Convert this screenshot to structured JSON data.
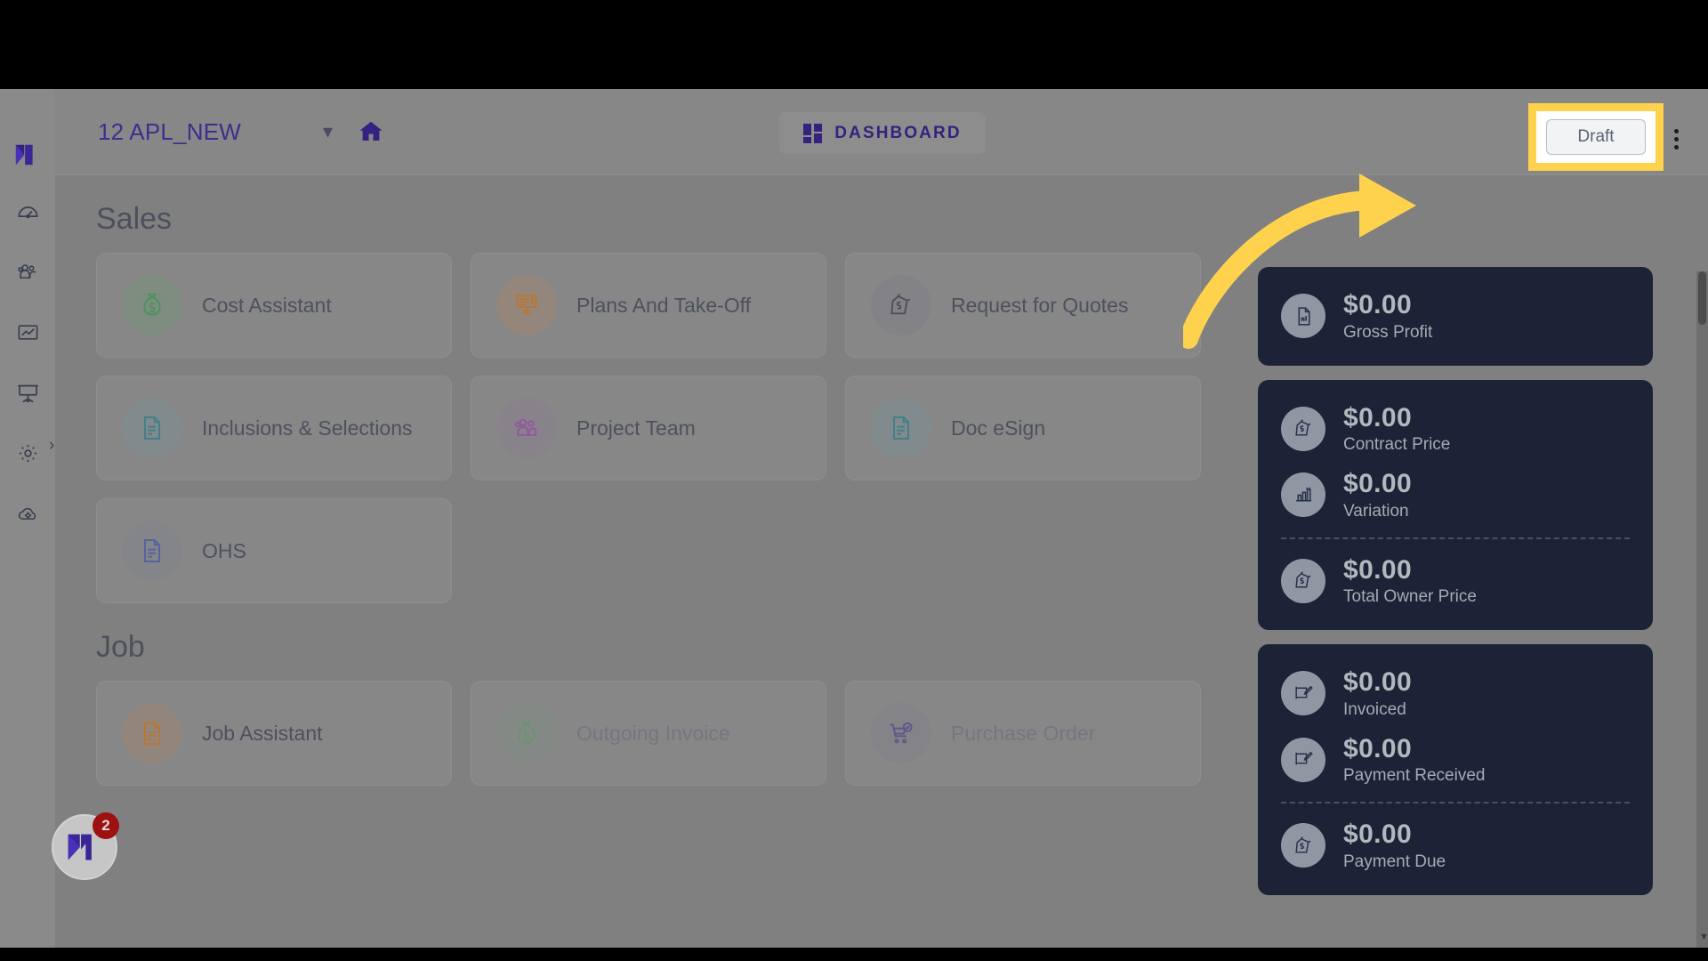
{
  "topbar": {
    "project_name": "12 APL_NEW",
    "chevron": "chevron-down",
    "home_icon": "home-icon",
    "dashboard_label": "DASHBOARD",
    "draft_label": "Draft",
    "kebab": "more-options"
  },
  "sidebar": {
    "items": [
      {
        "icon": "speedometer-icon",
        "name": "dashboard"
      },
      {
        "icon": "people-group-icon",
        "name": "contacts"
      },
      {
        "icon": "chart-frame-icon",
        "name": "reports"
      },
      {
        "icon": "presentation-board-icon",
        "name": "plans"
      },
      {
        "icon": "gear-icon",
        "name": "settings"
      },
      {
        "icon": "cloud-gear-icon",
        "name": "integrations"
      }
    ],
    "expand_chevron": "›"
  },
  "sections": [
    {
      "title": "Sales",
      "cards": [
        {
          "label": "Cost Assistant",
          "icon": "money-bag-icon",
          "color": "#2f9e44",
          "bg": "rgba(91,173,104,0.30)",
          "faded": false
        },
        {
          "label": "Plans And Take-Off",
          "icon": "presentation-icon",
          "color": "#d9730d",
          "bg": "rgba(209,134,70,0.30)",
          "faded": false
        },
        {
          "label": "Request for Quotes",
          "icon": "price-tag-icon",
          "color": "#2c3247",
          "bg": "rgba(120,124,140,0.34)",
          "faded": false
        },
        {
          "label": "Inclusions & Selections",
          "icon": "document-icon",
          "color": "#1e7f8e",
          "bg": "rgba(106,160,172,0.28)",
          "faded": false
        },
        {
          "label": "Project Team",
          "icon": "people-group-icon",
          "color": "#a33bb5",
          "bg": "rgba(150,110,170,0.22)",
          "faded": false
        },
        {
          "label": "Doc eSign",
          "icon": "document-icon",
          "color": "#1e7f8e",
          "bg": "rgba(106,160,172,0.28)",
          "faded": false
        },
        {
          "label": "OHS",
          "icon": "document-icon",
          "color": "#3b52b5",
          "bg": "rgba(120,128,160,0.22)",
          "faded": false
        }
      ]
    },
    {
      "title": "Job",
      "cards": [
        {
          "label": "Job Assistant",
          "icon": "document-icon",
          "color": "#d9730d",
          "bg": "rgba(209,134,70,0.26)",
          "faded": false
        },
        {
          "label": "Outgoing Invoice",
          "icon": "money-bag-icon",
          "color": "#5d9f68",
          "bg": "rgba(110,160,120,0.20)",
          "faded": true
        },
        {
          "label": "Purchase Order",
          "icon": "cart-check-icon",
          "color": "#4b3f8f",
          "bg": "rgba(120,118,150,0.20)",
          "faded": true
        }
      ]
    }
  ],
  "stats": {
    "groups": [
      {
        "rows": [
          {
            "value": "$0.00",
            "label": "Gross Profit",
            "icon": "document-report-icon"
          }
        ]
      },
      {
        "rows": [
          {
            "value": "$0.00",
            "label": "Contract Price",
            "icon": "price-tag-icon"
          },
          {
            "value": "$0.00",
            "label": "Variation",
            "icon": "bar-chart-icon"
          },
          {
            "value": "$0.00",
            "label": "Total Owner Price",
            "icon": "price-tag-icon"
          }
        ],
        "separator_after": 1
      },
      {
        "rows": [
          {
            "value": "$0.00",
            "label": "Invoiced",
            "icon": "invoice-edit-icon"
          },
          {
            "value": "$0.00",
            "label": "Payment Received",
            "icon": "invoice-edit-icon"
          },
          {
            "value": "$0.00",
            "label": "Payment Due",
            "icon": "price-tag-icon"
          }
        ],
        "separator_after": 1
      }
    ]
  },
  "chat_widget": {
    "badge_count": "2",
    "icon": "brand-logo-icon"
  },
  "colors": {
    "brand_purple": "#35217e",
    "highlight_yellow": "#ffd24d",
    "panel_dark": "#1c2336",
    "badge_red": "#9d1111"
  }
}
